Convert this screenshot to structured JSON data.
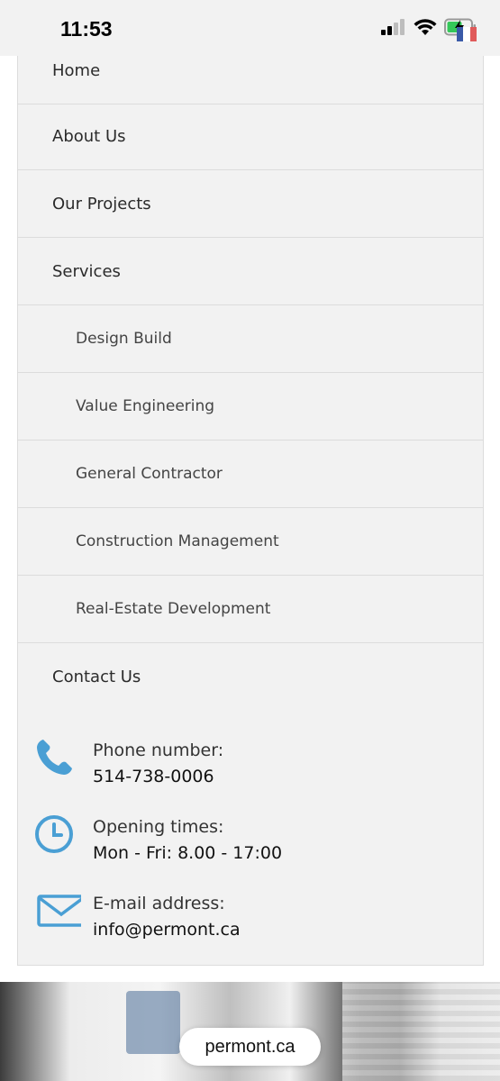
{
  "status_bar": {
    "time": "11:53",
    "icons": [
      "signal-icon",
      "wifi-icon",
      "battery-charging-icon"
    ],
    "flag_colors": [
      "#3a5aa8",
      "#ffffff",
      "#e05a5a"
    ]
  },
  "menu": {
    "items": [
      {
        "label": "Home",
        "level": 0
      },
      {
        "label": "About Us",
        "level": 0
      },
      {
        "label": "Our Projects",
        "level": 0
      },
      {
        "label": "Services",
        "level": 0
      },
      {
        "label": "Design Build",
        "level": 1
      },
      {
        "label": "Value Engineering",
        "level": 1
      },
      {
        "label": "General Contractor",
        "level": 1
      },
      {
        "label": "Construction Management",
        "level": 1
      },
      {
        "label": "Real-Estate Development",
        "level": 1
      },
      {
        "label": "Contact Us",
        "level": 0
      }
    ]
  },
  "contact": {
    "accent_color": "#4a9fd4",
    "phone": {
      "label": "Phone number:",
      "value": "514-738-0006",
      "icon": "phone-icon"
    },
    "hours": {
      "label": "Opening times:",
      "value": "Mon - Fri: 8.00 - 17:00",
      "icon": "clock-icon"
    },
    "email": {
      "label": "E-mail address:",
      "value": "info@permont.ca",
      "icon": "mail-icon"
    }
  },
  "browser": {
    "url": "permont.ca"
  }
}
